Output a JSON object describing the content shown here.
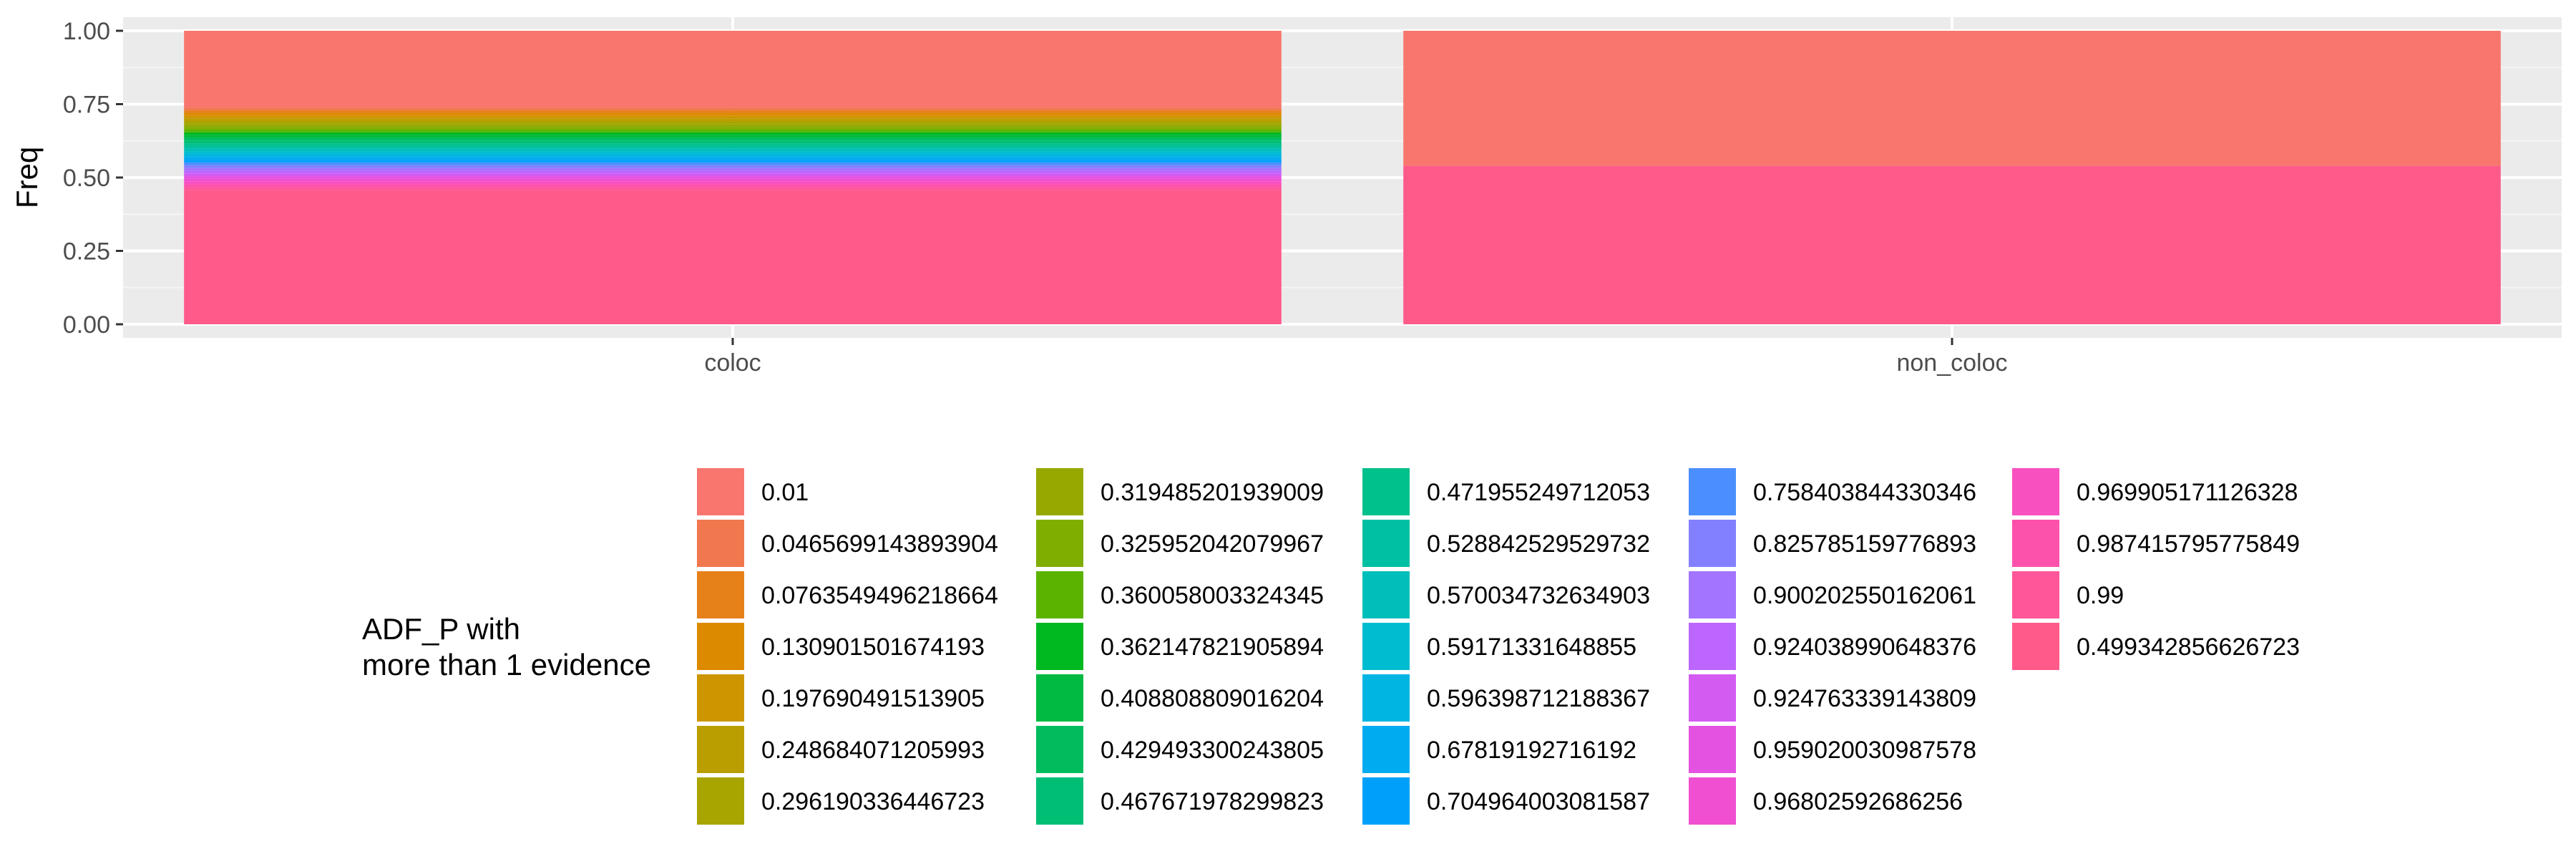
{
  "chart_data": {
    "type": "bar",
    "stacked": true,
    "position": "fill",
    "ylabel": "Freq",
    "xlabel": "",
    "ylim": [
      0,
      1
    ],
    "yticks": [
      "0.00",
      "0.25",
      "0.50",
      "0.75",
      "1.00"
    ],
    "categories": [
      "coloc",
      "non_coloc"
    ],
    "legend_title": [
      "ADF_P with",
      "more than 1 evidence"
    ],
    "legend_position": "bottom",
    "grid": true,
    "series": [
      {
        "name": "0.01",
        "color": "#F8766D",
        "values": [
          0.28,
          0.46
        ]
      },
      {
        "name": "0.0465699143893904",
        "color": "#F1774F",
        "values": [
          0.01,
          0
        ]
      },
      {
        "name": "0.0763549496218664",
        "color": "#E6811A",
        "values": [
          0.01,
          0
        ]
      },
      {
        "name": "0.130901501674193",
        "color": "#DC8A00",
        "values": [
          0.01,
          0
        ]
      },
      {
        "name": "0.197690491513905",
        "color": "#CD9600",
        "values": [
          0.01,
          0
        ]
      },
      {
        "name": "0.248684071205993",
        "color": "#BA9E00",
        "values": [
          0.01,
          0
        ]
      },
      {
        "name": "0.296190336446723",
        "color": "#A8A400",
        "values": [
          0.01,
          0
        ]
      },
      {
        "name": "0.319485201939009",
        "color": "#96A900",
        "values": [
          0.01,
          0
        ]
      },
      {
        "name": "0.325952042079967",
        "color": "#7FAE00",
        "values": [
          0.01,
          0
        ]
      },
      {
        "name": "0.360058003324345",
        "color": "#5BB300",
        "values": [
          0.01,
          0
        ]
      },
      {
        "name": "0.362147821905894",
        "color": "#00B81F",
        "values": [
          0.01,
          0
        ]
      },
      {
        "name": "0.408808809016204",
        "color": "#00BA41",
        "values": [
          0.01,
          0
        ]
      },
      {
        "name": "0.429493300243805",
        "color": "#00BC5D",
        "values": [
          0.01,
          0
        ]
      },
      {
        "name": "0.467671978299823",
        "color": "#00BE73",
        "values": [
          0.01,
          0
        ]
      },
      {
        "name": "0.471955249712053",
        "color": "#00C08B",
        "values": [
          0.01,
          0
        ]
      },
      {
        "name": "0.528842529529732",
        "color": "#00C0A3",
        "values": [
          0.01,
          0
        ]
      },
      {
        "name": "0.570034732634903",
        "color": "#00BFBA",
        "values": [
          0.01,
          0
        ]
      },
      {
        "name": "0.59171331648855",
        "color": "#00BCD0",
        "values": [
          0.01,
          0
        ]
      },
      {
        "name": "0.596398712188367",
        "color": "#00B5E2",
        "values": [
          0.01,
          0
        ]
      },
      {
        "name": "0.67819192716192",
        "color": "#00ABF0",
        "values": [
          0.01,
          0
        ]
      },
      {
        "name": "0.704964003081587",
        "color": "#00A0FA",
        "values": [
          0.01,
          0
        ]
      },
      {
        "name": "0.758403844330346",
        "color": "#4B8FFF",
        "values": [
          0.01,
          0
        ]
      },
      {
        "name": "0.825785159776893",
        "color": "#8280FF",
        "values": [
          0.01,
          0
        ]
      },
      {
        "name": "0.900202550162061",
        "color": "#A374FF",
        "values": [
          0.01,
          0
        ]
      },
      {
        "name": "0.924038990648376",
        "color": "#BD66FF",
        "values": [
          0.01,
          0
        ]
      },
      {
        "name": "0.924763339143809",
        "color": "#D45BF2",
        "values": [
          0.01,
          0
        ]
      },
      {
        "name": "0.959020030987578",
        "color": "#E352E0",
        "values": [
          0.01,
          0
        ]
      },
      {
        "name": "0.96802592686256",
        "color": "#F04FD1",
        "values": [
          0.01,
          0
        ]
      },
      {
        "name": "0.969905171126328",
        "color": "#F950C0",
        "values": [
          0.01,
          0
        ]
      },
      {
        "name": "0.987415795775849",
        "color": "#FD52AC",
        "values": [
          0.01,
          0
        ]
      },
      {
        "name": "0.99",
        "color": "#FF5699",
        "values": [
          0.01,
          0
        ]
      },
      {
        "name": "0.499342856626723",
        "color": "#FF5A8A",
        "values": [
          0.49,
          0.54
        ]
      }
    ]
  }
}
